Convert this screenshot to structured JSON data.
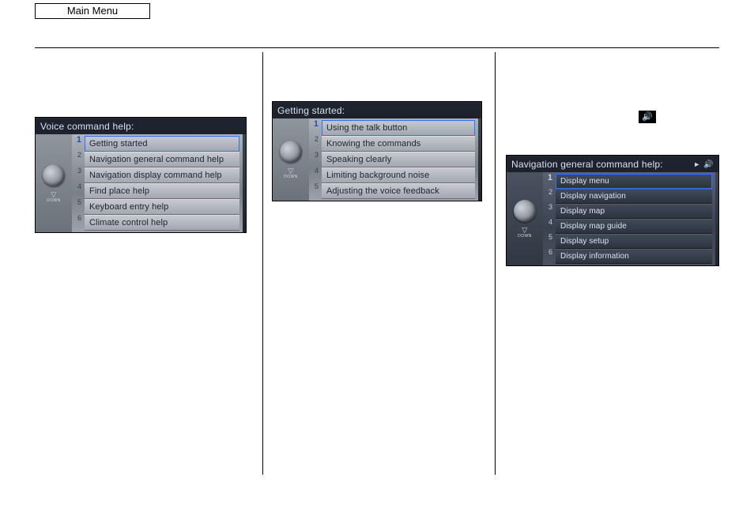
{
  "main_menu_label": "Main Menu",
  "speaker_icon_glyph": "🔊",
  "voice_panel": {
    "title": "Voice command help:",
    "down_label": "DOWN",
    "items": [
      "Getting started",
      "Navigation general command help",
      "Navigation display command help",
      "Find place help",
      "Keyboard entry help",
      "Climate control help"
    ],
    "numbers": [
      "1",
      "2",
      "3",
      "4",
      "5",
      "6"
    ],
    "selected_index": 0
  },
  "start_panel": {
    "title": "Getting started:",
    "down_label": "DOWN",
    "items": [
      "Using the talk button",
      "Knowing the commands",
      "Speaking clearly",
      "Limiting background noise",
      "Adjusting the voice feedback"
    ],
    "numbers": [
      "1",
      "2",
      "3",
      "4",
      "5"
    ],
    "selected_index": 0
  },
  "nav_panel": {
    "title": "Navigation general command help:",
    "play_glyph": "►",
    "speaker_glyph": "🔊",
    "down_label": "DOWN",
    "items": [
      "Display menu",
      "Display navigation",
      "Display map",
      "Display map guide",
      "Display setup",
      "Display information"
    ],
    "numbers": [
      "1",
      "2",
      "3",
      "4",
      "5",
      "6"
    ],
    "selected_index": 0
  }
}
